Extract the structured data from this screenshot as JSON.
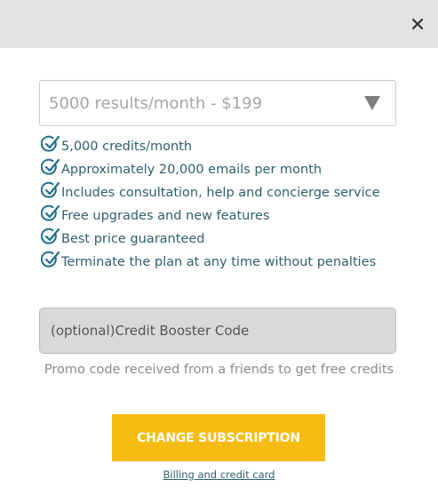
{
  "modal": {
    "close_label": "×"
  },
  "plan": {
    "selected": "5000 results/month - $199"
  },
  "features": [
    "5,000 credits/month",
    "Approximately 20,000 emails per month",
    "Includes consultation, help and concierge service",
    "Free upgrades and new features",
    "Best price guaranteed",
    "Terminate the plan at any time without penalties"
  ],
  "booster": {
    "placeholder": "(optional)Credit Booster Code",
    "value": "",
    "note": "Promo code received from a friends to get free credits"
  },
  "actions": {
    "change_subscription": "CHANGE SUBSCRIPTION",
    "billing_link": "Billing and credit card"
  },
  "colors": {
    "accent_button": "#f5bb12",
    "feature_text": "#2e5f70",
    "check_icon": "#1f6f8b"
  }
}
